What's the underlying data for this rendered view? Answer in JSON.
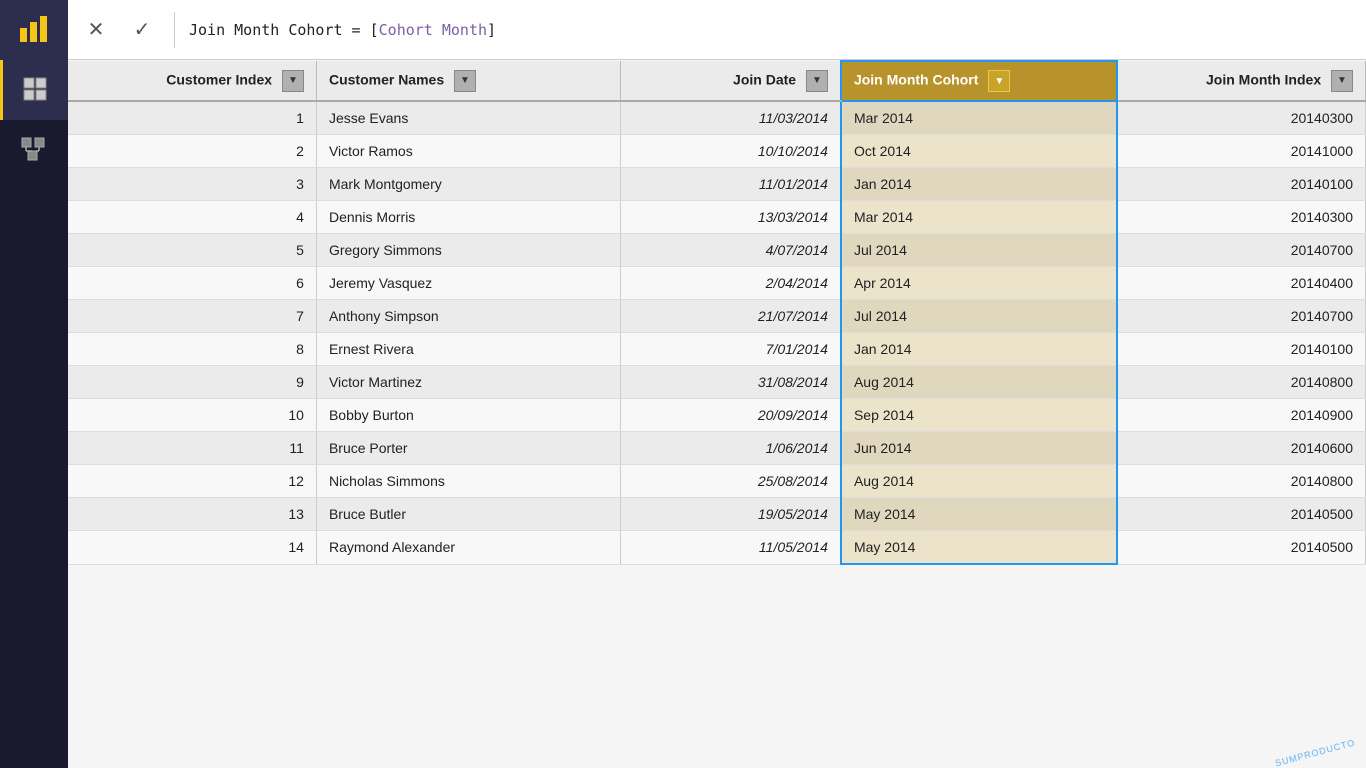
{
  "sidebar": {
    "logo_icon": "bar-chart-icon",
    "items": [
      {
        "name": "table-view-icon",
        "icon": "⊞",
        "active": true
      },
      {
        "name": "model-view-icon",
        "icon": "⧉",
        "active": false
      }
    ]
  },
  "formula_bar": {
    "cancel_label": "✕",
    "confirm_label": "✓",
    "formula_text": "Join Month Cohort = [Cohort Month]",
    "formula_prefix": "Join Month Cohort = [",
    "formula_middle": "Cohort Month",
    "formula_suffix": "]"
  },
  "table": {
    "columns": [
      {
        "key": "customer_index",
        "label": "Customer Index",
        "highlighted": false
      },
      {
        "key": "customer_names",
        "label": "Customer Names",
        "highlighted": false
      },
      {
        "key": "join_date",
        "label": "Join Date",
        "highlighted": false
      },
      {
        "key": "join_month_cohort",
        "label": "Join Month Cohort",
        "highlighted": true
      },
      {
        "key": "join_month_index",
        "label": "Join Month Index",
        "highlighted": false
      }
    ],
    "rows": [
      {
        "customer_index": "1",
        "customer_names": "Jesse Evans",
        "join_date": "11/03/2014",
        "join_month_cohort": "Mar 2014",
        "join_month_index": "20140300"
      },
      {
        "customer_index": "2",
        "customer_names": "Victor Ramos",
        "join_date": "10/10/2014",
        "join_month_cohort": "Oct 2014",
        "join_month_index": "20141000"
      },
      {
        "customer_index": "3",
        "customer_names": "Mark Montgomery",
        "join_date": "11/01/2014",
        "join_month_cohort": "Jan 2014",
        "join_month_index": "20140100"
      },
      {
        "customer_index": "4",
        "customer_names": "Dennis Morris",
        "join_date": "13/03/2014",
        "join_month_cohort": "Mar 2014",
        "join_month_index": "20140300"
      },
      {
        "customer_index": "5",
        "customer_names": "Gregory Simmons",
        "join_date": "4/07/2014",
        "join_month_cohort": "Jul 2014",
        "join_month_index": "20140700"
      },
      {
        "customer_index": "6",
        "customer_names": "Jeremy Vasquez",
        "join_date": "2/04/2014",
        "join_month_cohort": "Apr 2014",
        "join_month_index": "20140400"
      },
      {
        "customer_index": "7",
        "customer_names": "Anthony Simpson",
        "join_date": "21/07/2014",
        "join_month_cohort": "Jul 2014",
        "join_month_index": "20140700"
      },
      {
        "customer_index": "8",
        "customer_names": "Ernest Rivera",
        "join_date": "7/01/2014",
        "join_month_cohort": "Jan 2014",
        "join_month_index": "20140100"
      },
      {
        "customer_index": "9",
        "customer_names": "Victor Martinez",
        "join_date": "31/08/2014",
        "join_month_cohort": "Aug 2014",
        "join_month_index": "20140800"
      },
      {
        "customer_index": "10",
        "customer_names": "Bobby Burton",
        "join_date": "20/09/2014",
        "join_month_cohort": "Sep 2014",
        "join_month_index": "20140900"
      },
      {
        "customer_index": "11",
        "customer_names": "Bruce Porter",
        "join_date": "1/06/2014",
        "join_month_cohort": "Jun 2014",
        "join_month_index": "20140600"
      },
      {
        "customer_index": "12",
        "customer_names": "Nicholas Simmons",
        "join_date": "25/08/2014",
        "join_month_cohort": "Aug 2014",
        "join_month_index": "20140800"
      },
      {
        "customer_index": "13",
        "customer_names": "Bruce Butler",
        "join_date": "19/05/2014",
        "join_month_cohort": "May 2014",
        "join_month_index": "20140500"
      },
      {
        "customer_index": "14",
        "customer_names": "Raymond Alexander",
        "join_date": "11/05/2014",
        "join_month_cohort": "May 2014",
        "join_month_index": "20140500"
      }
    ]
  },
  "watermark": "SUMPRODUCTO"
}
